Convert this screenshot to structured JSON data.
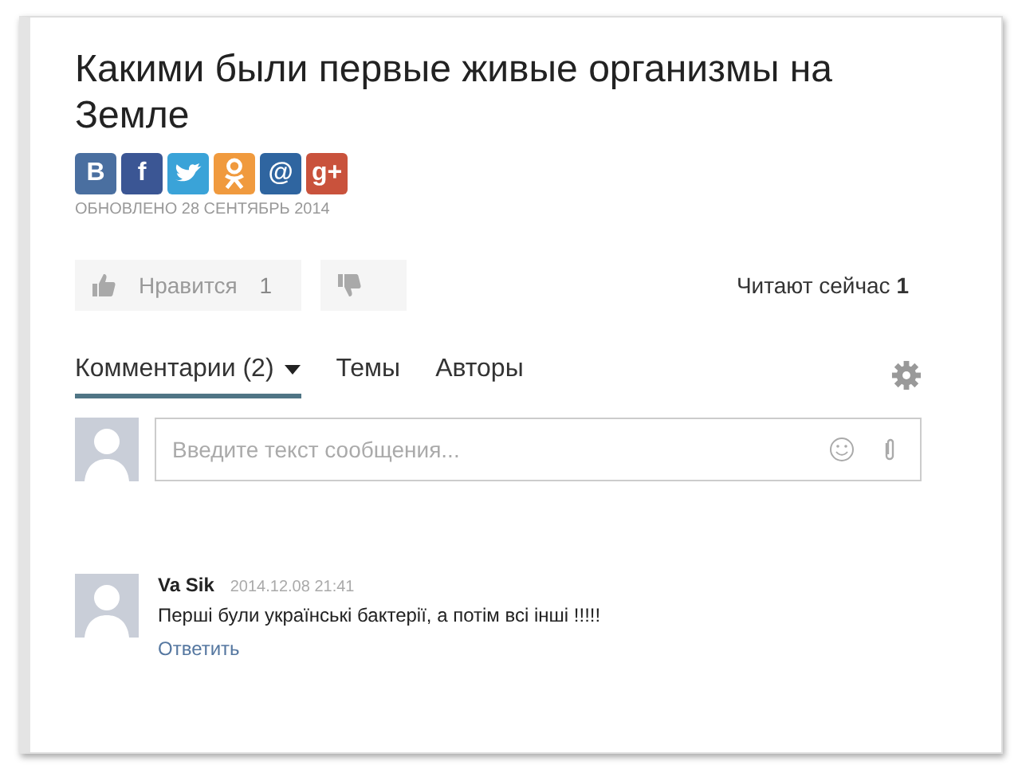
{
  "article": {
    "title": "Какими были первые живые организмы на Земле",
    "updated": "ОБНОВЛЕНО 28 СЕНТЯБРЬ 2014"
  },
  "share": [
    {
      "kind": "glyph",
      "glyph": "B",
      "color": "#4a6fa0"
    },
    {
      "kind": "glyph",
      "glyph": "f",
      "color": "#3b5694"
    },
    {
      "kind": "bird",
      "color": "#3aa3d8"
    },
    {
      "kind": "ok",
      "color": "#f09a3e"
    },
    {
      "kind": "glyph",
      "glyph": "@",
      "color": "#2f65a0"
    },
    {
      "kind": "glyph",
      "glyph": "g+",
      "color": "#c9523c"
    }
  ],
  "likes": {
    "label": "Нравится",
    "count": "1"
  },
  "reading": {
    "label": "Читают сейчас",
    "count": "1"
  },
  "tabs": [
    {
      "label": "Комментарии (2)",
      "selected": true,
      "dropdown": true
    },
    {
      "label": "Темы",
      "selected": false,
      "dropdown": false
    },
    {
      "label": "Авторы",
      "selected": false,
      "dropdown": false
    }
  ],
  "composer": {
    "placeholder": "Введите текст сообщения..."
  },
  "comments": [
    {
      "author": "Va Sik",
      "time": "2014.12.08 21:41",
      "text": "Перші були українські бактерії, а потім всі інші !!!!!",
      "reply": "Ответить"
    }
  ]
}
